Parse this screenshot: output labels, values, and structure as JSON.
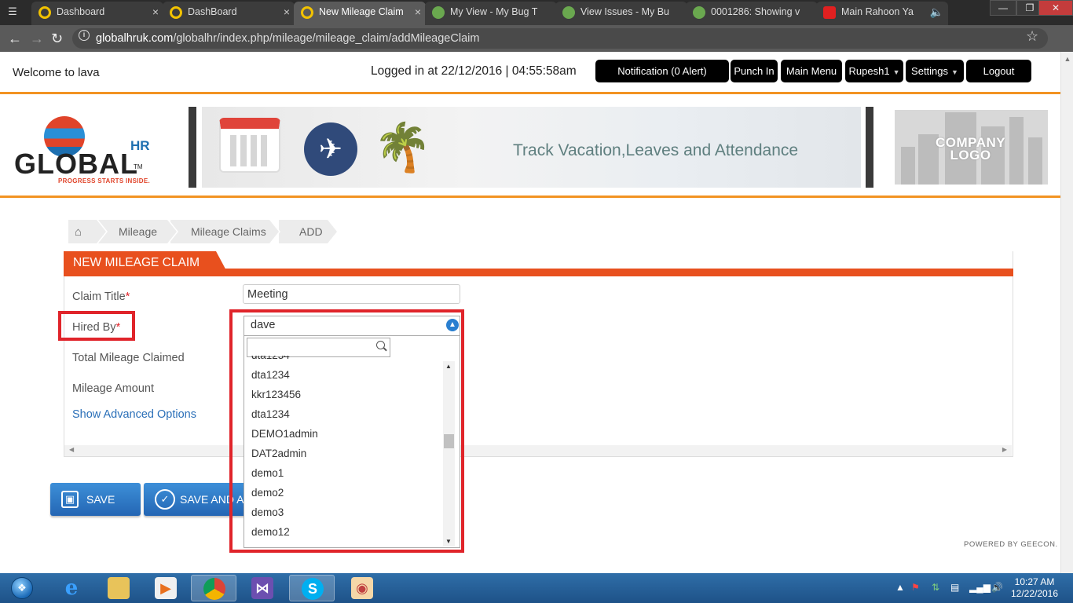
{
  "browser": {
    "tabs": [
      {
        "label": "Dashboard",
        "icon_color": "#f2c200",
        "active": false
      },
      {
        "label": "DashBoard",
        "icon_color": "#f2c200",
        "active": false
      },
      {
        "label": "New Mileage Claim",
        "icon_color": "#f2c200",
        "active": true
      },
      {
        "label": "My View - My Bug T",
        "icon_color": "#6aa84f",
        "active": false
      },
      {
        "label": "View Issues - My Bu",
        "icon_color": "#6aa84f",
        "active": false
      },
      {
        "label": "0001286: Showing v",
        "icon_color": "#6aa84f",
        "active": false
      },
      {
        "label": "Main Rahoon Ya",
        "icon_color": "#e02020",
        "active": false
      }
    ],
    "close_glyph": "×",
    "url_host": "globalhruk.com",
    "url_path": "/globalhr/index.php/mileage/mileage_claim/addMileageClaim"
  },
  "header": {
    "welcome": "Welcome to lava",
    "logged_in": "Logged in at 22/12/2016 | 04:55:58am",
    "buttons": {
      "notification": "Notification (0 Alert)",
      "punch_in": "Punch In",
      "main_menu": "Main Menu",
      "user": "Rupesh1",
      "settings": "Settings",
      "logout": "Logout"
    }
  },
  "banner": {
    "logo_word": "GLOBAL",
    "logo_sup": "HR",
    "logo_tm": "TM",
    "logo_tag": "PROGRESS STARTS INSIDE.",
    "slogan": "Track Vacation,Leaves and Attendance",
    "company_logo_line1": "COMPANY",
    "company_logo_line2": "LOGO"
  },
  "breadcrumb": [
    "Mileage",
    "Mileage Claims",
    "ADD"
  ],
  "form": {
    "title": "NEW MILEAGE CLAIM",
    "claim_title_label": "Claim Title",
    "claim_title_value": "Meeting",
    "hired_by_label": "Hired By",
    "required_mark": "*",
    "total_mileage_label": "Total Mileage Claimed",
    "mileage_amount_label": "Mileage Amount",
    "advanced_link": "Show Advanced Options"
  },
  "dropdown": {
    "selected": "dave",
    "search_value": "",
    "options": [
      "dta1234",
      "dta1234",
      "kkr123456",
      "dta1234",
      "DEMO1admin",
      "DAT2admin",
      "demo1",
      "demo2",
      "demo3",
      "demo12"
    ]
  },
  "actions": {
    "save": "SAVE",
    "save_and": "SAVE AND A"
  },
  "footer": {
    "powered": "POWERED BY GEECON."
  },
  "taskbar": {
    "time": "10:27 AM",
    "date": "12/22/2016"
  },
  "colors": {
    "accent_orange": "#e8501e",
    "header_line": "#f29322",
    "highlight_red": "#e0242a",
    "button_blue": "#2466b4"
  }
}
